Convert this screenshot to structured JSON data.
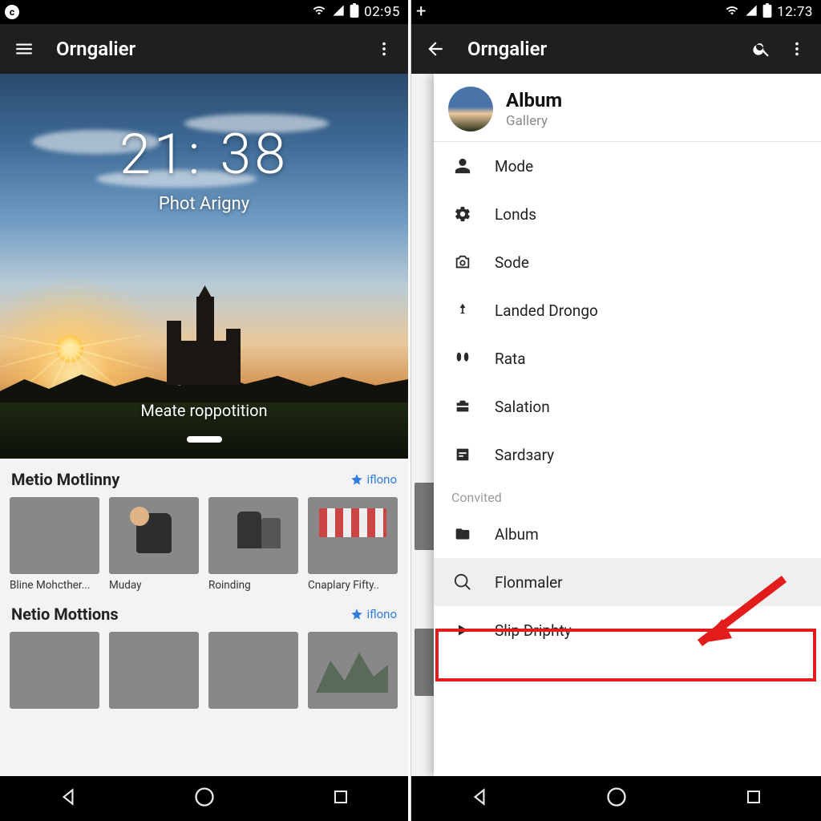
{
  "left": {
    "status": {
      "leading_badge": "c",
      "time": "02:95"
    },
    "appbar": {
      "title": "Orngalier"
    },
    "hero": {
      "time": "21:  38",
      "subtitle": "Phot Arigny",
      "caption": "Meate roppotition"
    },
    "sections": [
      {
        "title": "Metio Motlinny",
        "more": "iflono",
        "items": [
          {
            "caption": "Bline Mohcther...",
            "img": "sunset"
          },
          {
            "caption": "Muday",
            "img": "grass"
          },
          {
            "caption": "Roinding",
            "img": "park"
          },
          {
            "caption": "Cnaplary Fifty..",
            "img": "market"
          }
        ]
      },
      {
        "title": "Netio Mottions",
        "more": "iflono",
        "items": [
          {
            "caption": "",
            "img": "sky"
          },
          {
            "caption": "",
            "img": "forest"
          },
          {
            "caption": "",
            "img": "lake"
          },
          {
            "caption": "",
            "img": "mtn"
          }
        ]
      }
    ]
  },
  "right": {
    "status": {
      "leading_badge": "+",
      "time": "12:73"
    },
    "appbar": {
      "title": "Orngalier"
    },
    "drawer": {
      "header": {
        "title": "Album",
        "subtitle": "Gallery"
      },
      "items": [
        {
          "icon": "person",
          "label": "Mode"
        },
        {
          "icon": "gear",
          "label": "Londs"
        },
        {
          "icon": "camera",
          "label": "Sode"
        },
        {
          "icon": "pin",
          "label": "Landed Drongo"
        },
        {
          "icon": "hands",
          "label": "Rata"
        },
        {
          "icon": "briefcase",
          "label": "Salation"
        },
        {
          "icon": "slider",
          "label": "Sardзary"
        }
      ],
      "group_label": "Convited",
      "items2": [
        {
          "icon": "folder",
          "label": "Album"
        },
        {
          "icon": "search",
          "label": "Flonmaler",
          "highlighted": true
        },
        {
          "icon": "play",
          "label": "Slip Driphty"
        }
      ]
    }
  }
}
